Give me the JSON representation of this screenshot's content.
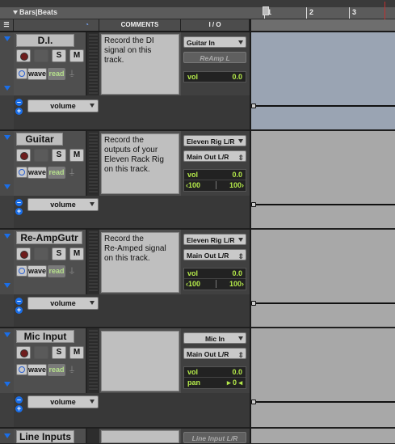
{
  "ruler": {
    "label": "Bars|Beats",
    "ticks": [
      "1",
      "2",
      "3"
    ]
  },
  "columns": {
    "comments": "COMMENTS",
    "io": "I / O"
  },
  "colors": {
    "accent": "#1a6ee8",
    "meter_text": "#b5ea4a",
    "edit_bg_audio": "#9aa4b3",
    "edit_bg_aux": "#a8a8a8"
  },
  "tracks": [
    {
      "name": "D.I.",
      "comment": "Record the DI\nsignal on this\ntrack.",
      "input": "Guitar In",
      "output": "ReAmp L",
      "output_disabled": true,
      "vol_label": "vol",
      "vol": "0.0",
      "pan_left": "",
      "pan_right": "",
      "automation": "volume",
      "buttons": {
        "solo": "S",
        "mute": "M",
        "wave": "wave",
        "read": "read"
      }
    },
    {
      "name": "Guitar",
      "comment": "Record the\noutputs of your\nEleven Rack Rig\non this track.",
      "input": "Eleven Rig L/R",
      "output": "Main Out L/R",
      "output_disabled": false,
      "vol_label": "vol",
      "vol": "0.0",
      "pan_left": "‹100",
      "pan_right": "100›",
      "automation": "volume",
      "buttons": {
        "solo": "S",
        "mute": "M",
        "wave": "wave",
        "read": "read"
      }
    },
    {
      "name": "Re-AmpGutr",
      "comment": "Record the\nRe-Amped signal\non this track.",
      "input": "Eleven Rig L/R",
      "output": "Main Out L/R",
      "output_disabled": false,
      "vol_label": "vol",
      "vol": "0.0",
      "pan_left": "‹100",
      "pan_right": "100›",
      "automation": "volume",
      "buttons": {
        "solo": "S",
        "mute": "M",
        "wave": "wave",
        "read": "read"
      }
    },
    {
      "name": "Mic Input",
      "comment": "",
      "input": "Mic In",
      "output": "Main Out L/R",
      "output_disabled": false,
      "vol_label": "vol",
      "vol": "0.0",
      "pan_label": "pan",
      "pan": "▸ 0 ◂",
      "automation": "volume",
      "buttons": {
        "solo": "S",
        "mute": "M",
        "wave": "wave",
        "read": "read"
      }
    },
    {
      "name": "Line Inputs",
      "input": "Line Input L/R"
    }
  ]
}
